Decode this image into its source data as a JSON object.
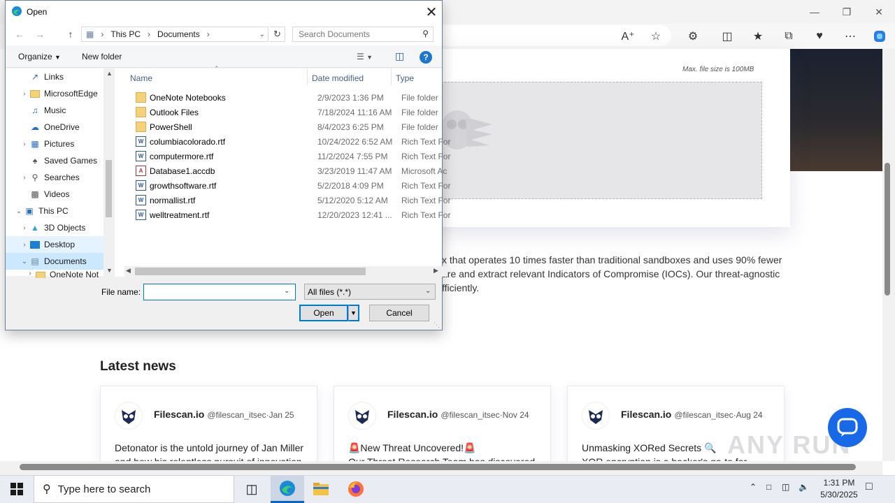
{
  "browser": {
    "upload": {
      "max_size": "Max. file size is 100MB"
    },
    "description": {
      "line1": "x that operates 10 times faster than traditional sandboxes and uses 90% fewer",
      "line2": "are and extract relevant Indicators of Compromise (IOCs). Our threat-agnostic",
      "line3": "fficiently."
    },
    "news": {
      "heading": "Latest news",
      "cards": [
        {
          "name": "Filescan.io",
          "handle": "@filescan_itsec·Jan 25",
          "line1": "Detonator is the untold journey of Jan Miller",
          "line2": "and how his relentless pursuit of innovation"
        },
        {
          "name": "Filescan.io",
          "handle": "@filescan_itsec·Nov 24",
          "line1": "🚨New Threat Uncovered!🚨",
          "line2": "Our Threat Research Team has discovered"
        },
        {
          "name": "Filescan.io",
          "handle": "@filescan_itsec·Aug 24",
          "line1": "Unmasking XORed Secrets 🔍",
          "line2": "XOR encryption is a hacker's go-to for"
        }
      ]
    },
    "watermark": "ANY RUN"
  },
  "dialog": {
    "title": "Open",
    "breadcrumb": [
      "This PC",
      "Documents"
    ],
    "search_placeholder": "Search Documents",
    "organize": "Organize",
    "new_folder": "New folder",
    "help": "?",
    "tree": [
      {
        "label": "Links",
        "expandable": false
      },
      {
        "label": "MicrosoftEdge",
        "expandable": true
      },
      {
        "label": "Music",
        "expandable": false
      },
      {
        "label": "OneDrive",
        "expandable": false
      },
      {
        "label": "Pictures",
        "expandable": true
      },
      {
        "label": "Saved Games",
        "expandable": false
      },
      {
        "label": "Searches",
        "expandable": true
      },
      {
        "label": "Videos",
        "expandable": false
      },
      {
        "label": "This PC",
        "expandable": true
      },
      {
        "label": "3D Objects",
        "expandable": true
      },
      {
        "label": "Desktop",
        "expandable": true
      },
      {
        "label": "Documents",
        "expandable": true
      },
      {
        "label": "OneNote Not",
        "expandable": true
      }
    ],
    "columns": {
      "name": "Name",
      "date": "Date modified",
      "type": "Type"
    },
    "files": [
      {
        "name": "OneNote Notebooks",
        "date": "2/9/2023 1:36 PM",
        "type": "File folder",
        "kind": "folder"
      },
      {
        "name": "Outlook Files",
        "date": "7/18/2024 11:16 AM",
        "type": "File folder",
        "kind": "folder"
      },
      {
        "name": "PowerShell",
        "date": "8/4/2023 6:25 PM",
        "type": "File folder",
        "kind": "folder"
      },
      {
        "name": "columbiacolorado.rtf",
        "date": "10/24/2022 6:52 AM",
        "type": "Rich Text For",
        "kind": "doc"
      },
      {
        "name": "computermore.rtf",
        "date": "11/2/2024 7:55 PM",
        "type": "Rich Text For",
        "kind": "doc"
      },
      {
        "name": "Database1.accdb",
        "date": "3/23/2019 11:47 AM",
        "type": "Microsoft Ac",
        "kind": "acc"
      },
      {
        "name": "growthsoftware.rtf",
        "date": "5/2/2018 4:09 PM",
        "type": "Rich Text For",
        "kind": "doc"
      },
      {
        "name": "normallist.rtf",
        "date": "5/12/2020 5:12 AM",
        "type": "Rich Text For",
        "kind": "doc"
      },
      {
        "name": "welltreatment.rtf",
        "date": "12/20/2023 12:41 ...",
        "type": "Rich Text For",
        "kind": "doc"
      }
    ],
    "file_name_label": "File name:",
    "file_name_value": "",
    "file_type": "All files (*.*)",
    "open_button": "Open",
    "cancel_button": "Cancel"
  },
  "taskbar": {
    "search_placeholder": "Type here to search",
    "time": "1:31 PM",
    "date": "5/30/2025"
  },
  "colors": {
    "accent": "#0078d7",
    "selection": "#cce8ff",
    "chat": "#1769e8"
  }
}
